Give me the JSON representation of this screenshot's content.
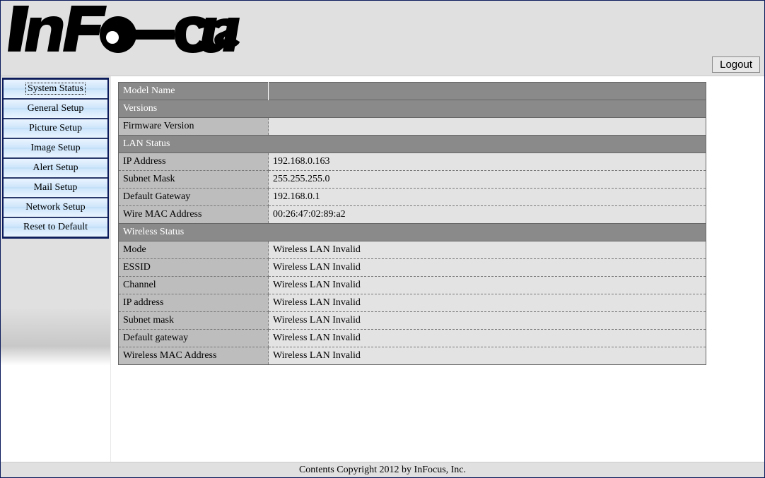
{
  "brand": "InFocus",
  "logout_label": "Logout",
  "nav": {
    "items": [
      {
        "label": "System Status",
        "active": true
      },
      {
        "label": "General Setup",
        "active": false
      },
      {
        "label": "Picture Setup",
        "active": false
      },
      {
        "label": "Image Setup",
        "active": false
      },
      {
        "label": "Alert Setup",
        "active": false
      },
      {
        "label": "Mail Setup",
        "active": false
      },
      {
        "label": "Network Setup",
        "active": false
      },
      {
        "label": "Reset to Default",
        "active": false
      }
    ]
  },
  "table": {
    "model_name_label": "Model Name",
    "model_name_value": "",
    "sections": [
      {
        "header": "Versions",
        "rows": [
          {
            "label": "Firmware Version",
            "value": ""
          }
        ]
      },
      {
        "header": "LAN Status",
        "rows": [
          {
            "label": "IP Address",
            "value": "192.168.0.163"
          },
          {
            "label": "Subnet Mask",
            "value": "255.255.255.0"
          },
          {
            "label": "Default Gateway",
            "value": "192.168.0.1"
          },
          {
            "label": "Wire MAC Address",
            "value": "00:26:47:02:89:a2"
          }
        ]
      },
      {
        "header": "Wireless Status",
        "rows": [
          {
            "label": "Mode",
            "value": "Wireless LAN Invalid"
          },
          {
            "label": "ESSID",
            "value": "Wireless LAN Invalid"
          },
          {
            "label": "Channel",
            "value": "Wireless LAN Invalid"
          },
          {
            "label": "IP address",
            "value": "Wireless LAN Invalid"
          },
          {
            "label": "Subnet mask",
            "value": "Wireless LAN Invalid"
          },
          {
            "label": "Default gateway",
            "value": "Wireless LAN Invalid"
          },
          {
            "label": "Wireless MAC Address",
            "value": "Wireless LAN Invalid"
          }
        ]
      }
    ]
  },
  "footer": "Contents Copyright 2012 by InFocus, Inc."
}
